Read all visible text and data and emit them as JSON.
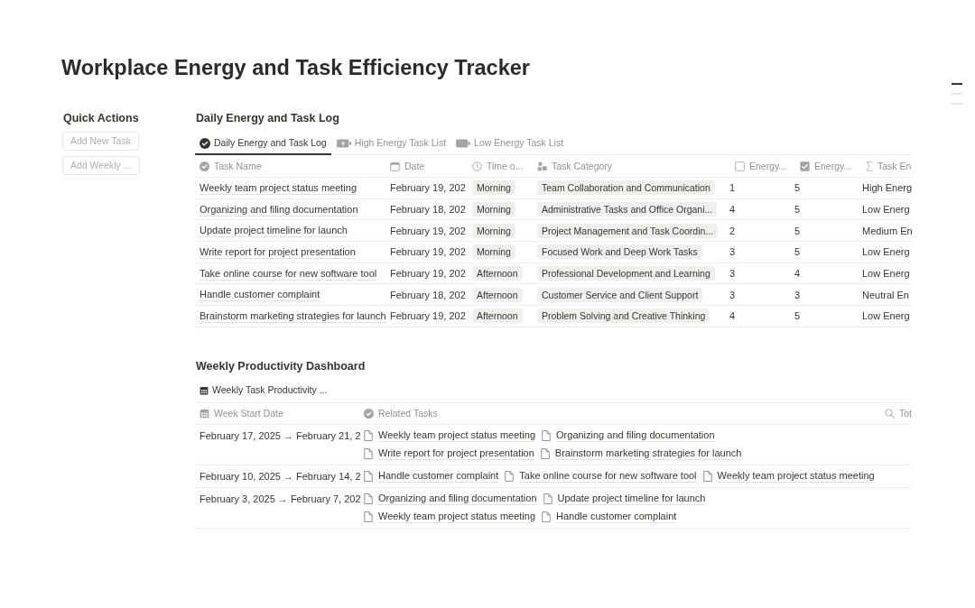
{
  "page_title": "Workplace Energy and Task Efficiency Tracker",
  "quick_actions": {
    "title": "Quick Actions",
    "buttons": [
      "Add New Task",
      "Add Weekly ..."
    ]
  },
  "daily_log": {
    "title": "Daily Energy and Task Log",
    "tabs": [
      {
        "label": "Daily Energy and Task Log",
        "selected": true
      },
      {
        "label": "High Energy Task List",
        "selected": false
      },
      {
        "label": "Low Energy Task List",
        "selected": false
      }
    ],
    "columns": [
      {
        "label": "Task Name",
        "kind": "title"
      },
      {
        "label": "Date",
        "kind": "text"
      },
      {
        "label": "Time o...",
        "kind": "select"
      },
      {
        "label": "Task Category",
        "kind": "select"
      },
      {
        "label": "Energy...",
        "kind": "number"
      },
      {
        "label": "Energy...",
        "kind": "number"
      },
      {
        "label": "Task En",
        "kind": "text"
      }
    ],
    "rows": [
      {
        "cells": [
          "Weekly team project status meeting",
          "February 19, 202",
          "Morning",
          "Team Collaboration and Communication",
          "1",
          "5",
          "High Energ"
        ]
      },
      {
        "cells": [
          "Organizing and filing documentation",
          "February 18, 202",
          "Morning",
          "Administrative Tasks and Office Organi...",
          "4",
          "5",
          "Low Energ"
        ]
      },
      {
        "cells": [
          "Update project timeline for launch",
          "February 19, 202",
          "Morning",
          "Project Management and Task Coordin...",
          "2",
          "5",
          "Medium En"
        ]
      },
      {
        "cells": [
          "Write report for project presentation",
          "February 19, 202",
          "Morning",
          "Focused Work and Deep Work Tasks",
          "3",
          "5",
          "Low Energ"
        ]
      },
      {
        "cells": [
          "Take online course for new software tool",
          "February 19, 202",
          "Afternoon",
          "Professional Development and Learning",
          "3",
          "4",
          "Low Energ"
        ]
      },
      {
        "cells": [
          "Handle customer complaint",
          "February 18, 202",
          "Afternoon",
          "Customer Service and Client Support",
          "3",
          "3",
          "Neutral En"
        ]
      },
      {
        "cells": [
          "Brainstorm marketing strategies for launch",
          "February 19, 202",
          "Afternoon",
          "Problem Solving and Creative Thinking",
          "4",
          "5",
          "Low Energ"
        ]
      }
    ]
  },
  "weekly_dashboard": {
    "title": "Weekly Productivity Dashboard",
    "view_tab": "Weekly Task Productivity ...",
    "columns": [
      "Week Start Date",
      "Related Tasks",
      "Tot"
    ],
    "rows": [
      {
        "week_start_date": "February 17, 2025 → February 21, 2",
        "related_tasks": [
          "Weekly team project status meeting",
          "Organizing and filing documentation",
          "Write report for project presentation",
          "Brainstorm marketing strategies for launch"
        ]
      },
      {
        "week_start_date": "February 10, 2025 → February 14, 2",
        "related_tasks": [
          "Handle customer complaint",
          "Take online course for new software tool",
          "Weekly team project status meeting"
        ]
      },
      {
        "week_start_date": "February 3, 2025 → February 7, 202",
        "related_tasks": [
          "Organizing and filing documentation",
          "Update project timeline for launch",
          "Weekly team project status meeting",
          "Handle customer complaint"
        ]
      }
    ]
  }
}
